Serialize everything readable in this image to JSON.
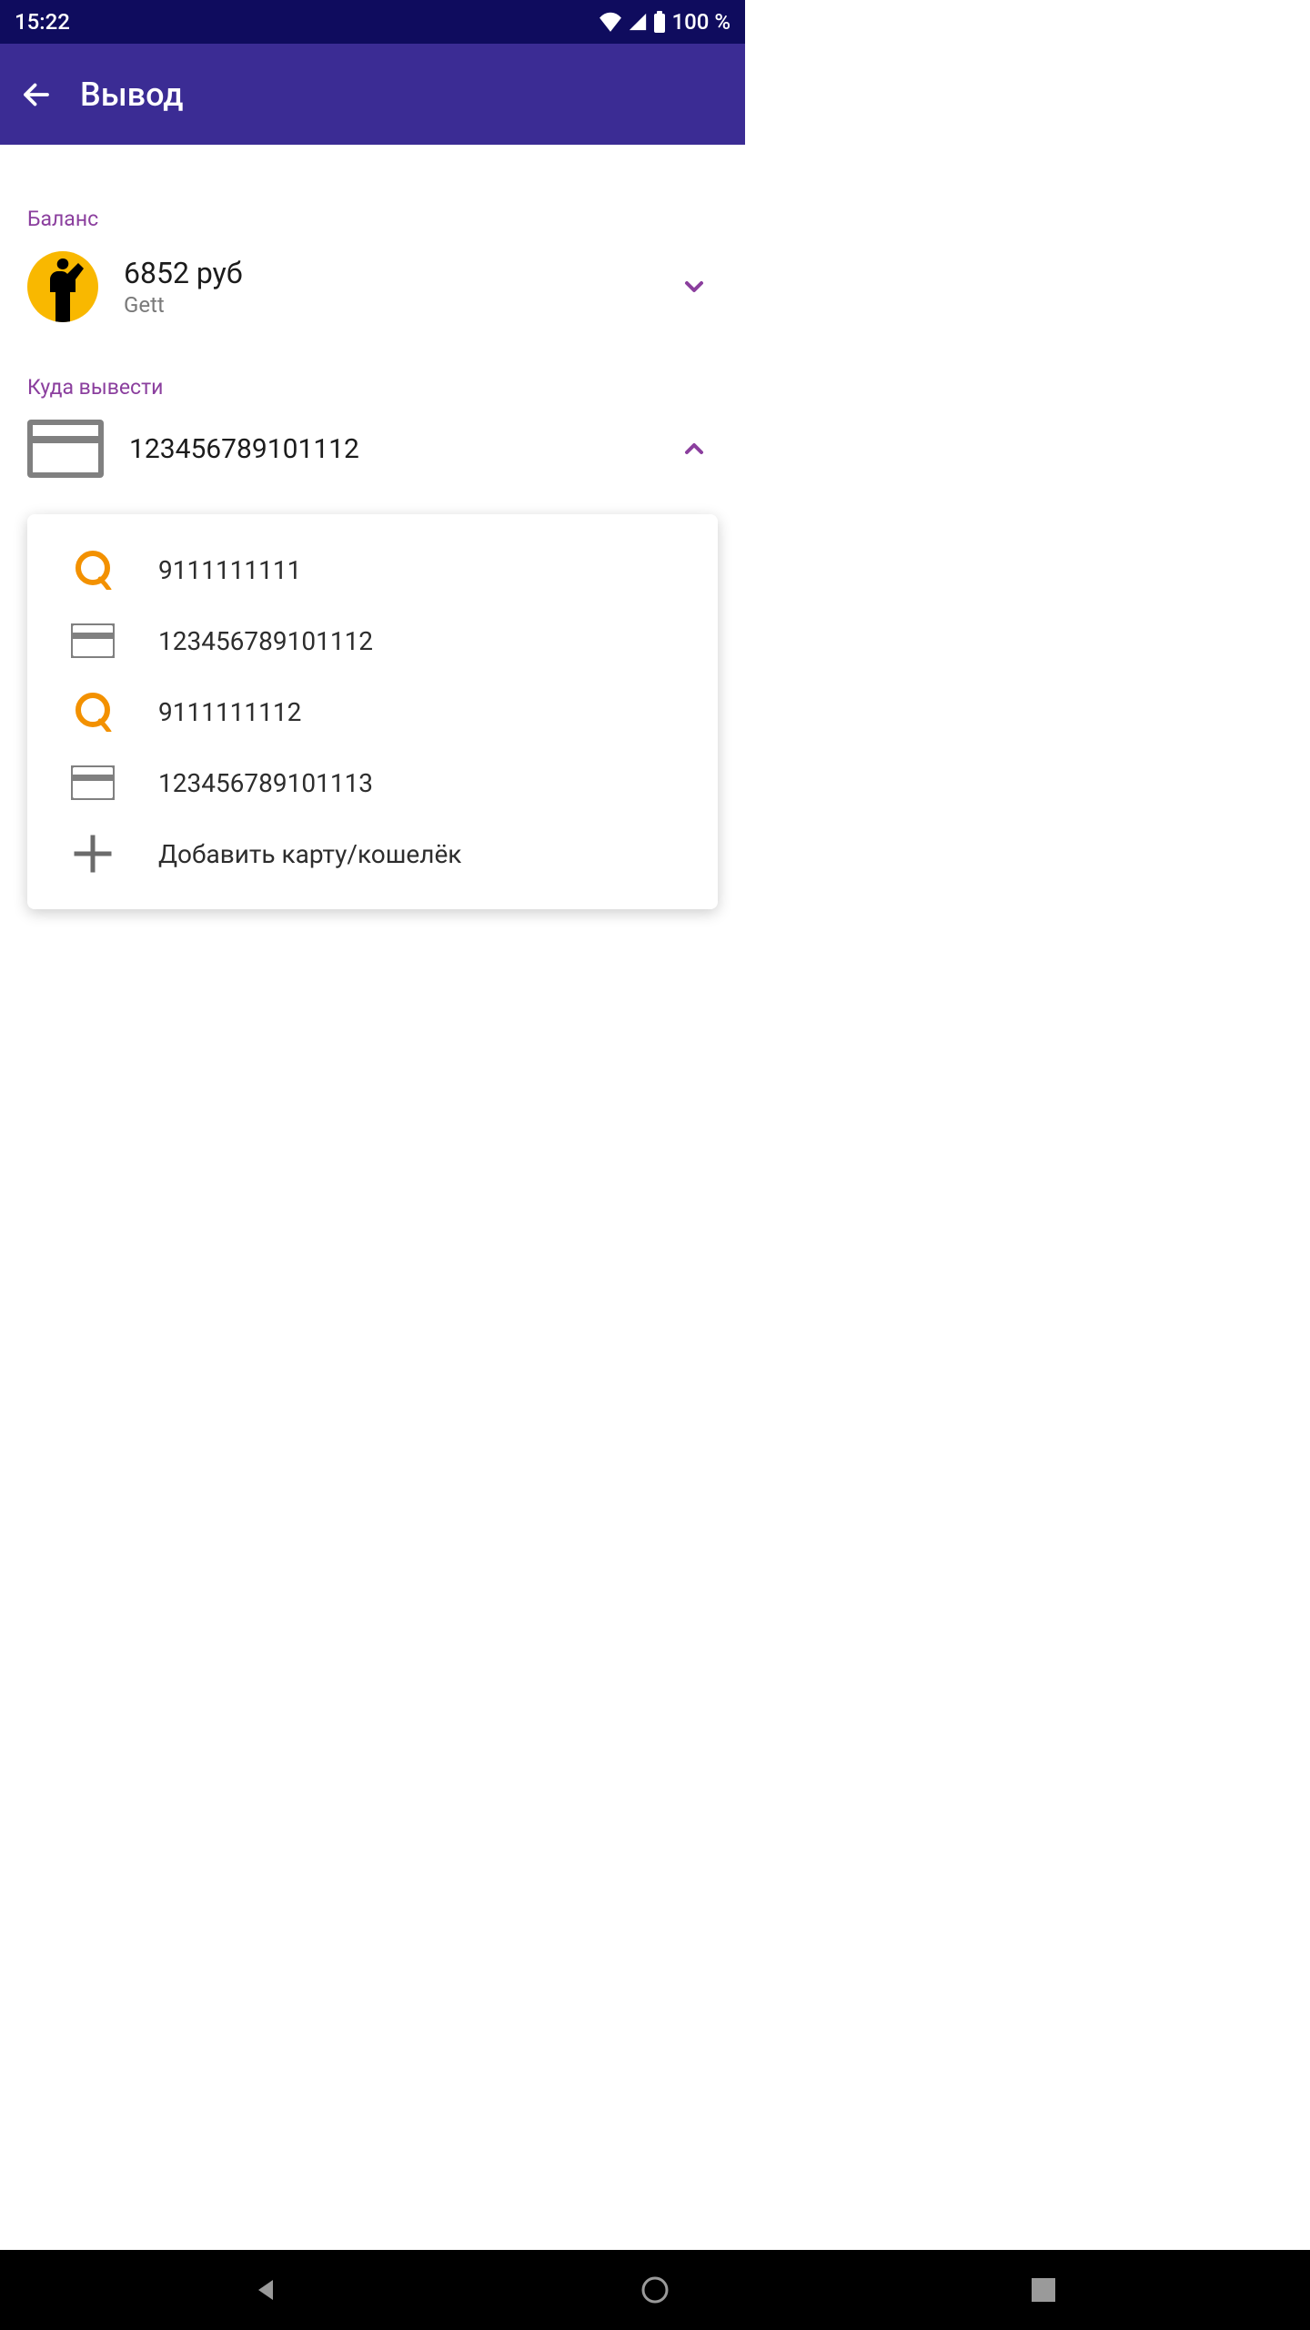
{
  "status": {
    "time": "15:22",
    "battery": "100 %"
  },
  "appbar": {
    "title": "Вывод"
  },
  "balance": {
    "label": "Баланс",
    "amount": "6852 руб",
    "service": "Gett"
  },
  "destination": {
    "label": "Куда вывести",
    "selected": "123456789101112"
  },
  "dropdown": {
    "items": [
      {
        "type": "qiwi",
        "label": "9111111111"
      },
      {
        "type": "card",
        "label": "123456789101112"
      },
      {
        "type": "qiwi",
        "label": "9111111112"
      },
      {
        "type": "card",
        "label": "123456789101113"
      }
    ],
    "add_label": "Добавить карту/кошелёк"
  }
}
